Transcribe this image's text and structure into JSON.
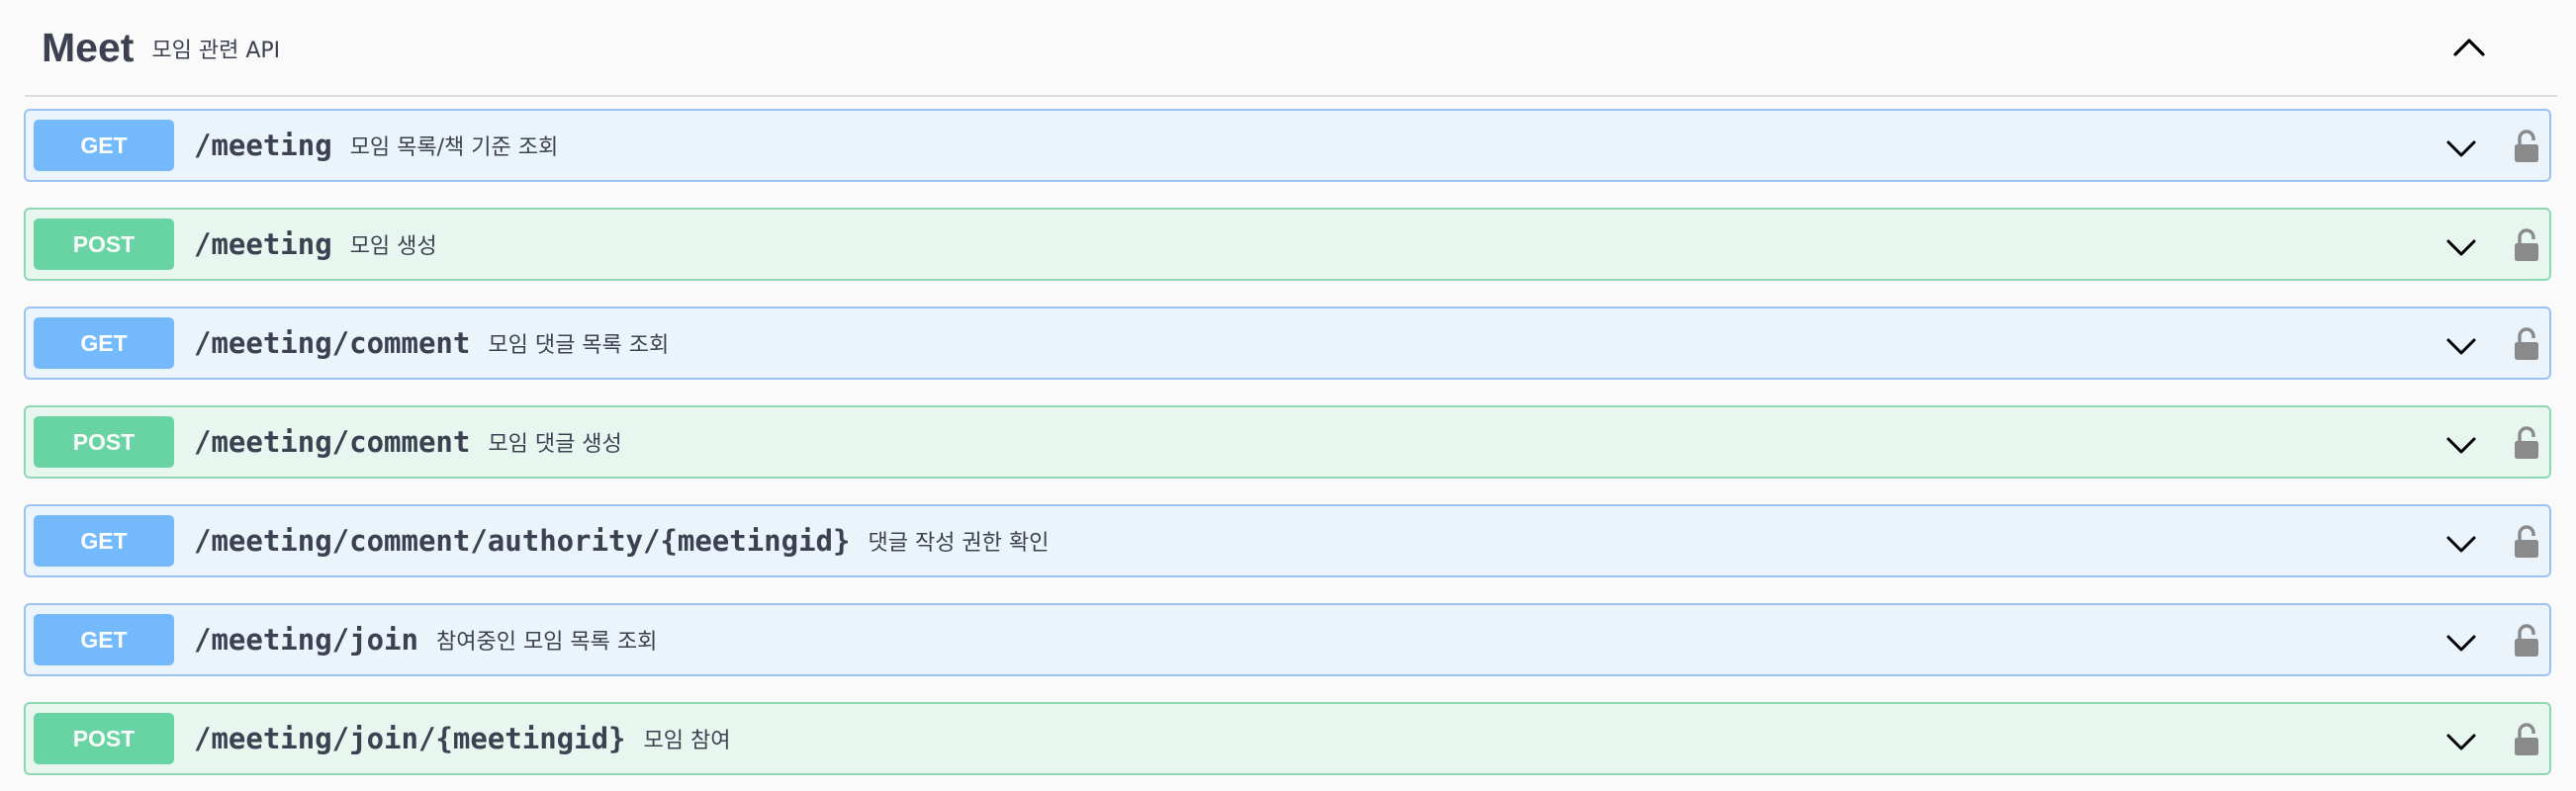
{
  "tag": {
    "name": "Meet",
    "description": "모임 관련 API",
    "collapse_icon": "chevron-up-icon"
  },
  "operations": [
    {
      "method": "GET",
      "path": "/meeting",
      "summary": "모임 목록/책 기준 조회"
    },
    {
      "method": "POST",
      "path": "/meeting",
      "summary": "모임 생성"
    },
    {
      "method": "GET",
      "path": "/meeting/comment",
      "summary": "모임 댓글 목록 조회"
    },
    {
      "method": "POST",
      "path": "/meeting/comment",
      "summary": "모임 댓글 생성"
    },
    {
      "method": "GET",
      "path": "/meeting/comment/authority/{meetingid}",
      "summary": "댓글 작성 권한 확인"
    },
    {
      "method": "GET",
      "path": "/meeting/join",
      "summary": "참여중인 모임 목록 조회"
    },
    {
      "method": "POST",
      "path": "/meeting/join/{meetingid}",
      "summary": "모임 참여"
    }
  ],
  "colors": {
    "get": "#61affe",
    "post": "#49cc90",
    "text": "#3b4151",
    "lock": "#8a8a8a"
  },
  "icons": {
    "expand": "chevron-down-icon",
    "auth": "lock-icon"
  }
}
